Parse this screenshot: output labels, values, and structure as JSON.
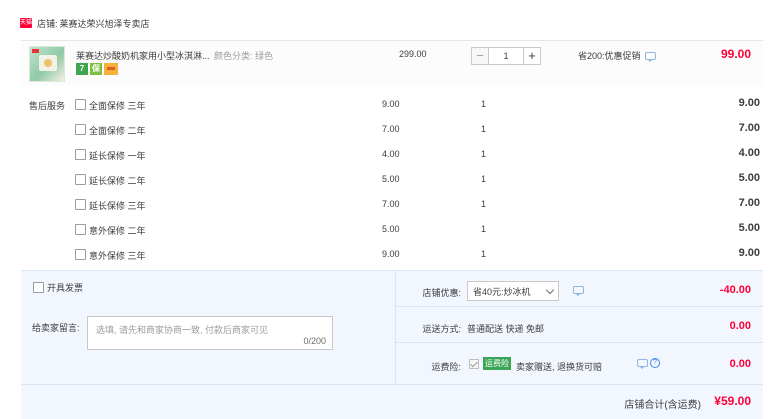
{
  "shop": {
    "tag": "天猫",
    "label": "店铺:",
    "name": "莱赛达荣兴旭泽专卖店"
  },
  "item": {
    "title": "莱赛达炒酸奶机家用小型冰淇淋...",
    "sku": "颜色分类: 绿色",
    "badge_seven": "7",
    "badge_guarantee": "保",
    "unit_price": "299.00",
    "qty_minus": "−",
    "qty": "1",
    "qty_plus": "+",
    "discount": "省200:优惠促销",
    "total": "99.00"
  },
  "services": {
    "label": "售后服务",
    "items": [
      {
        "name": "全面保修 三年",
        "price": "9.00",
        "qty": "1",
        "total": "9.00"
      },
      {
        "name": "全面保修 二年",
        "price": "7.00",
        "qty": "1",
        "total": "7.00"
      },
      {
        "name": "延长保修 一年",
        "price": "4.00",
        "qty": "1",
        "total": "4.00"
      },
      {
        "name": "延长保修 二年",
        "price": "5.00",
        "qty": "1",
        "total": "5.00"
      },
      {
        "name": "延长保修 三年",
        "price": "7.00",
        "qty": "1",
        "total": "7.00"
      },
      {
        "name": "意外保修 二年",
        "price": "5.00",
        "qty": "1",
        "total": "5.00"
      },
      {
        "name": "意外保修 三年",
        "price": "9.00",
        "qty": "1",
        "total": "9.00"
      }
    ]
  },
  "invoice": {
    "label": "开具发票"
  },
  "message": {
    "label": "给卖家留言:",
    "placeholder": "选填, 请先和商家协商一致, 付款后商家可见",
    "counter": "0/200"
  },
  "shop_discount": {
    "label": "店铺优惠:",
    "selected": "省40元:炒冰机",
    "value": "-40.00"
  },
  "shipping": {
    "label": "运送方式:",
    "method": "普通配送 快递 免邮",
    "value": "0.00"
  },
  "insurance": {
    "label": "运费险:",
    "badge": "运费险",
    "text": "卖家赠送, 退换货可赔",
    "value": "0.00"
  },
  "summary": {
    "label": "店铺合计(含运费)",
    "total": "¥59.00"
  }
}
